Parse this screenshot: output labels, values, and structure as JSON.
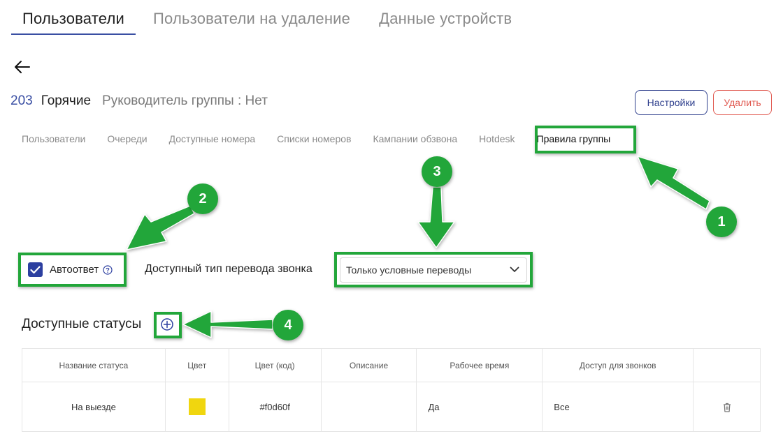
{
  "top_tabs": [
    {
      "label": "Пользователи",
      "active": true
    },
    {
      "label": "Пользователи на удаление",
      "active": false
    },
    {
      "label": "Данные устройств",
      "active": false
    }
  ],
  "group": {
    "id": "203",
    "name": "Горячие",
    "leader": "Руководитель группы : Нет"
  },
  "buttons": {
    "settings": "Настройки",
    "delete": "Удалить"
  },
  "sub_tabs": [
    {
      "label": "Пользователи",
      "active": false
    },
    {
      "label": "Очереди",
      "active": false
    },
    {
      "label": "Доступные номера",
      "active": false
    },
    {
      "label": "Списки номеров",
      "active": false
    },
    {
      "label": "Кампании обзвона",
      "active": false
    },
    {
      "label": "Hotdesk",
      "active": false
    },
    {
      "label": "Правила группы",
      "active": true
    }
  ],
  "rules": {
    "autoanswer_label": "Автоответ",
    "autoanswer_checked": true,
    "transfer_label": "Доступный тип перевода звонка",
    "transfer_value": "Только условные переводы"
  },
  "statuses": {
    "title": "Доступные статусы",
    "columns": [
      "Название статуса",
      "Цвет",
      "Цвет (код)",
      "Описание",
      "Рабочее время",
      "Доступ для звонков",
      ""
    ],
    "rows": [
      {
        "name": "На выезде",
        "color": "#f0d60f",
        "color_code": "#f0d60f",
        "description": "",
        "work_time": "Да",
        "call_access": "Все"
      }
    ]
  },
  "annotations": [
    "1",
    "2",
    "3",
    "4"
  ],
  "colors": {
    "accent": "#3a4fa3",
    "delete": "#e0584f",
    "highlight": "#22a63a"
  },
  "icons": [
    "back-arrow-icon",
    "help-circle-icon",
    "chevron-down-icon",
    "add-circle-icon",
    "trash-icon",
    "check-icon"
  ]
}
